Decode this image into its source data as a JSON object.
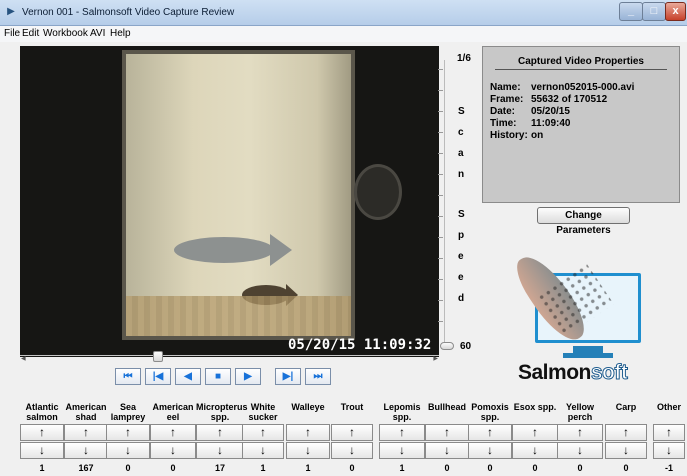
{
  "window": {
    "title": "Vernon 001 - Salmonsoft Video Capture Review",
    "icons": {
      "app": "video-icon",
      "minimize": "minimize-icon",
      "maximize": "maximize-icon",
      "close": "close-icon"
    }
  },
  "menu": [
    "File",
    "Edit",
    "Workbook",
    "AVI",
    "Help"
  ],
  "video": {
    "timestamp": "05/20/15 11:09:32"
  },
  "transport": {
    "buttons": [
      {
        "name": "first-frame",
        "glyph": "⏮"
      },
      {
        "name": "step-back",
        "glyph": "|◀"
      },
      {
        "name": "play-reverse",
        "glyph": "◀"
      },
      {
        "name": "stop",
        "glyph": "■"
      },
      {
        "name": "play",
        "glyph": "▶"
      },
      {
        "name": "step-forward",
        "glyph": "▶|"
      },
      {
        "name": "last-frame",
        "glyph": "⏭"
      }
    ]
  },
  "scan_speed": {
    "top_label": "1/6",
    "letters": [
      "S",
      "c",
      "a",
      "n",
      "S",
      "p",
      "e",
      "e",
      "d"
    ],
    "bottom_label": "60"
  },
  "properties": {
    "title": "Captured Video Properties",
    "rows": [
      {
        "key": "Name:",
        "value": "vernon052015-000.avi"
      },
      {
        "key": "Frame:",
        "value": "55632 of 170512"
      },
      {
        "key": "Date:",
        "value": "05/20/15"
      },
      {
        "key": "Time:",
        "value": "11:09:40"
      },
      {
        "key": "History:",
        "value": "on"
      }
    ],
    "change_button": "Change Parameters"
  },
  "logo": {
    "part1": "Salmon",
    "part2": "soft"
  },
  "species": [
    {
      "label1": "Atlantic",
      "label2": "salmon",
      "count": "1"
    },
    {
      "label1": "American",
      "label2": "shad",
      "count": "167"
    },
    {
      "label1": "Sea",
      "label2": "lamprey",
      "count": "0"
    },
    {
      "label1": "American",
      "label2": "eel",
      "count": "0"
    },
    {
      "label1": "Micropterus",
      "label2": "spp.",
      "count": "17"
    },
    {
      "label1": "White",
      "label2": "sucker",
      "count": "1"
    },
    {
      "label1": "Walleye",
      "label2": "",
      "count": "1"
    },
    {
      "label1": "Trout",
      "label2": "",
      "count": "0"
    },
    {
      "label1": "Lepomis",
      "label2": "spp.",
      "count": "1"
    },
    {
      "label1": "Bullhead",
      "label2": "",
      "count": "0"
    },
    {
      "label1": "Pomoxis",
      "label2": "spp.",
      "count": "0"
    },
    {
      "label1": "Esox spp.",
      "label2": "",
      "count": "0"
    },
    {
      "label1": "Yellow",
      "label2": "perch",
      "count": "0"
    },
    {
      "label1": "Carp",
      "label2": "",
      "count": "0"
    },
    {
      "label1": "Other",
      "label2": "",
      "count": "-1"
    }
  ],
  "arrows": {
    "up": "↑",
    "down": "↓"
  }
}
